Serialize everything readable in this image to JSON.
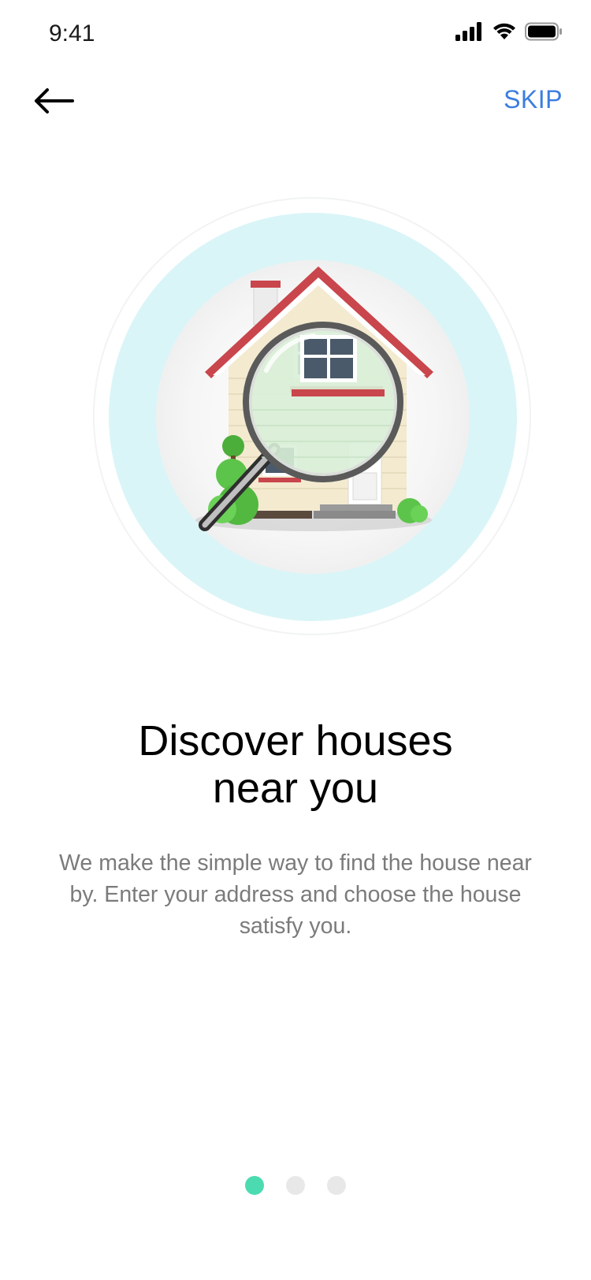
{
  "status_bar": {
    "time": "9:41"
  },
  "nav": {
    "back_icon": "arrow-left-icon",
    "skip_label": "SKIP"
  },
  "onboarding": {
    "illustration": "house-magnifier-illustration",
    "title_line1": "Discover houses",
    "title_line2": "near you",
    "description": "We make the simple way to find the house near by. Enter your address and choose the house satisfy you.",
    "page_count": 3,
    "current_page": 1
  },
  "colors": {
    "accent": "#3b7de0",
    "active_dot": "#4cdbb0",
    "inactive_dot": "#e8e8e8",
    "circle_bg": "#daf5f7",
    "roof_red": "#c9464c"
  }
}
